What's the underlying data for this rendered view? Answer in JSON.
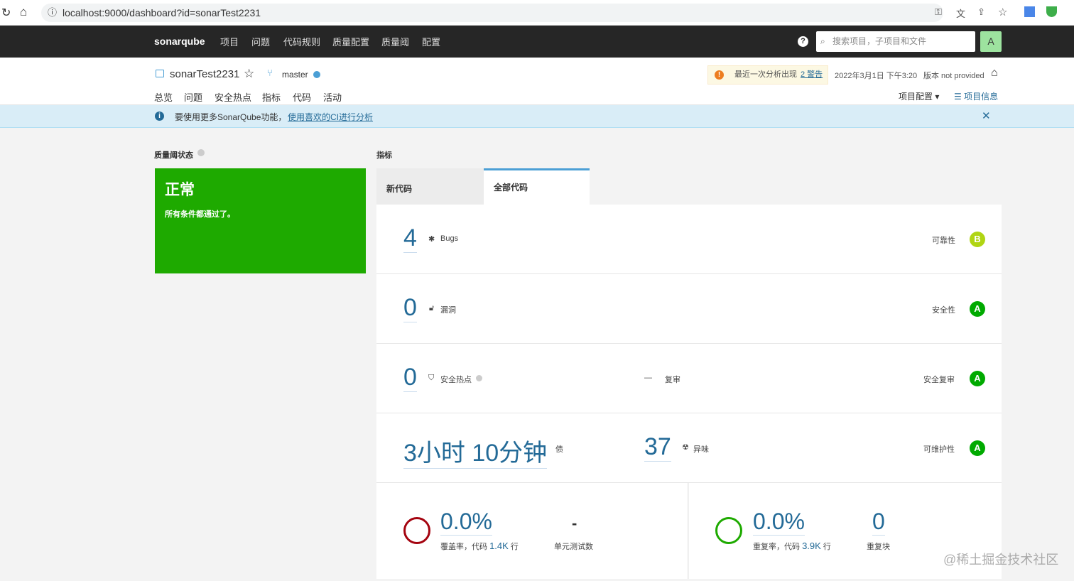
{
  "browser": {
    "url": "localhost:9000/dashboard?id=sonarTest2231"
  },
  "nav": {
    "logo": "sonarqube",
    "items": [
      "项目",
      "问题",
      "代码规则",
      "质量配置",
      "质量阈",
      "配置"
    ],
    "search_placeholder": "搜索项目，子项目和文件",
    "avatar": "A"
  },
  "project": {
    "name": "sonarTest2231",
    "branch": "master",
    "warning_text": "最近一次分析出现",
    "warning_link": "2 警告",
    "date": "2022年3月1日 下午3:20",
    "version": "版本 not provided",
    "tabs": [
      "总览",
      "问题",
      "安全热点",
      "指标",
      "代码",
      "活动"
    ],
    "config": "项目配置",
    "info": "项目信息"
  },
  "banner": {
    "text": "要使用更多SonarQube功能，",
    "link": "使用喜欢的CI进行分析"
  },
  "quality_gate": {
    "heading": "质量阈状态",
    "status": "正常",
    "message": "所有条件都通过了。"
  },
  "metrics": {
    "heading": "指标",
    "tabs": [
      "新代码",
      "全部代码"
    ],
    "bugs": {
      "value": "4",
      "label": "Bugs",
      "category": "可靠性",
      "rating": "B"
    },
    "vulns": {
      "value": "0",
      "label": "漏洞",
      "category": "安全性",
      "rating": "A"
    },
    "hotspots": {
      "value": "0",
      "label": "安全热点",
      "review_value": "—",
      "review_label": "复审",
      "category": "安全复审",
      "rating": "A"
    },
    "debt": {
      "value": "3小时 10分钟",
      "label": "债",
      "smells": "37",
      "smells_label": "异味",
      "category": "可维护性",
      "rating": "A"
    },
    "coverage": {
      "value": "0.0%",
      "label": "覆盖率，代码",
      "lines": "1.4K",
      "lines_suffix": "行",
      "tests": "-",
      "tests_label": "单元测试数"
    },
    "duplication": {
      "value": "0.0%",
      "label": "重复率，代码",
      "lines": "3.9K",
      "lines_suffix": "行",
      "blocks": "0",
      "blocks_label": "重复块"
    }
  },
  "watermark": "@稀土掘金技术社区",
  "colors": {
    "rating_a": "#00aa00",
    "rating_b": "#b0d513",
    "passed": "#1eaa00",
    "link": "#236a97"
  }
}
